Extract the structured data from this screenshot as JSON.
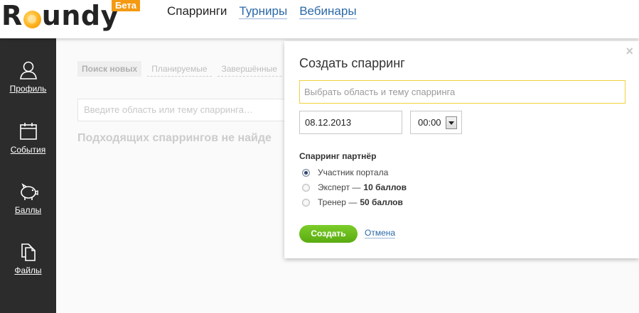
{
  "header": {
    "logo": {
      "before": "R",
      "after": "undy"
    },
    "beta_label": "Бета",
    "nav": [
      {
        "label": "Спарринги",
        "active": true
      },
      {
        "label": "Турниры",
        "active": false
      },
      {
        "label": "Вебинары",
        "active": false
      }
    ]
  },
  "sidebar": {
    "items": [
      {
        "label": "Профиль",
        "icon": "user-icon"
      },
      {
        "label": "События",
        "icon": "calendar-icon"
      },
      {
        "label": "Баллы",
        "icon": "piggy-bank-icon"
      },
      {
        "label": "Файлы",
        "icon": "files-icon"
      }
    ]
  },
  "main": {
    "tabs": [
      {
        "label": "Поиск новых",
        "selected": true
      },
      {
        "label": "Планируемые",
        "selected": false
      },
      {
        "label": "Завершённые",
        "selected": false
      }
    ],
    "search_placeholder": "Введите область или тему спарринга…",
    "not_found_text": "Подходящих спаррингов не найде"
  },
  "modal": {
    "title": "Создать спарринг",
    "close_glyph": "×",
    "topic_placeholder": "Выбрать область и тему спарринга",
    "date_value": "08.12.2013",
    "time_value": "00:00",
    "partner_heading": "Спарринг партнёр",
    "options": [
      {
        "label": "Участник портала",
        "extra": "",
        "selected": true
      },
      {
        "label": "Эксперт —",
        "extra": "10 баллов",
        "selected": false
      },
      {
        "label": "Тренер —",
        "extra": "50 баллов",
        "selected": false
      }
    ],
    "create_label": "Создать",
    "cancel_label": "Отмена"
  },
  "colors": {
    "accent_green": "#5aab10",
    "beta_orange": "#f39a12",
    "link_blue": "#2b68a8",
    "sidebar_bg": "#2c2c2c",
    "topic_border": "#f0d23c"
  }
}
